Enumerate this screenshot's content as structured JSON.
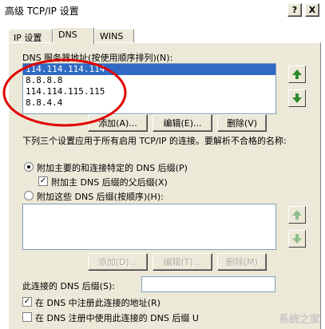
{
  "window": {
    "title": "高级 TCP/IP 设置",
    "help_label": "?",
    "close_label": "X"
  },
  "tabs": [
    {
      "label": "IP 设置"
    },
    {
      "label": "DNS"
    },
    {
      "label": "WINS"
    }
  ],
  "dns": {
    "list_label": "DNS 服务器地址(按使用顺序排列)(N):",
    "servers": [
      "114.114.114.114",
      "8.8.8.8",
      "114.114.115.115",
      "8.8.4.4"
    ],
    "add_label": "添加(A)...",
    "edit_label": "编辑(E)...",
    "delete_label": "删除(V)"
  },
  "suffix": {
    "description": "下列三个设置应用于所有启用 TCP/IP 的连接。要解析不合格的名称:",
    "radio_primary_label": "附加主要的和连接特定的 DNS 后缀(P)",
    "check_parent_label": "附加主 DNS 后缀的父后缀(X)",
    "radio_these_label": "附加这些 DNS 后缀(按顺序)(H):",
    "add_label": "添加(D)...",
    "edit_label": "编辑(T)...",
    "delete_label": "删除(M)"
  },
  "connection": {
    "suffix_label": "此连接的 DNS 后缀(S):",
    "suffix_value": "",
    "register_label": "在 DNS 中注册此连接的地址(R)",
    "use_suffix_label": "在 DNS 注册中使用此连接的 DNS 后缀 U"
  },
  "watermark": "系统之家",
  "colors": {
    "selection": "#316ac5",
    "annotation": "#e00000",
    "arrow": "#2e8b2e"
  }
}
